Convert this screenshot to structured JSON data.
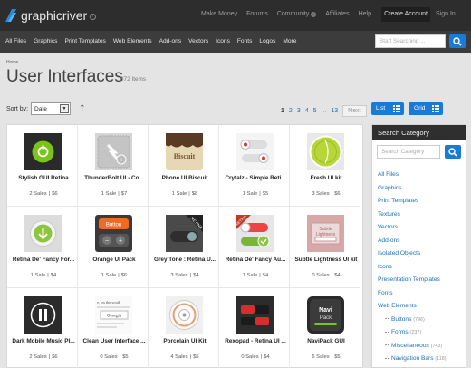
{
  "brand": {
    "name": "graphicriver"
  },
  "top_links": [
    "Make Money",
    "Forums",
    "Community",
    "Affiliates",
    "Help"
  ],
  "account": {
    "create": "Create Account",
    "signin": "Sign In"
  },
  "category_nav": [
    "All Files",
    "Graphics",
    "Print Templates",
    "Web Elements",
    "Add-ons",
    "Vectors",
    "Icons",
    "Fonts",
    "Logos",
    "More"
  ],
  "search": {
    "placeholder": "Start Searching ..."
  },
  "breadcrumb": "Home",
  "page": {
    "title": "User Interfaces",
    "count": "372 Items"
  },
  "sort": {
    "label": "Sort by:",
    "value": "Date"
  },
  "pagination": {
    "pages": [
      "1",
      "2",
      "3",
      "4",
      "5"
    ],
    "dots": "...",
    "last": "13",
    "next": "Next"
  },
  "view": {
    "list": "List",
    "grid": "Grid"
  },
  "items": [
    {
      "name": "Stylish GUI Retina",
      "sales": "2 Sales",
      "price": "$6"
    },
    {
      "name": "ThunderBolt UI - Co...",
      "sales": "1 Sale",
      "price": "$7"
    },
    {
      "name": "Phone UI Biscuit",
      "sales": "1 Sale",
      "price": "$8"
    },
    {
      "name": "Crytalz - Simple Reti...",
      "sales": "1 Sale",
      "price": "$5"
    },
    {
      "name": "Fresh UI kit",
      "sales": "3 Sales",
      "price": "$6"
    },
    {
      "name": "Retina De' Fancy For...",
      "sales": "1 Sale",
      "price": "$4"
    },
    {
      "name": "Orange UI Pack",
      "sales": "1 Sale",
      "price": "$6"
    },
    {
      "name": "Grey Tone : Retina U...",
      "sales": "3 Sales",
      "price": "$4"
    },
    {
      "name": "Retina De' Fancy Au...",
      "sales": "1 Sale",
      "price": "$4"
    },
    {
      "name": "Subtle Lightness UI kit",
      "sales": "0 Sales",
      "price": "$4"
    },
    {
      "name": "Dark Mobile Music Pl...",
      "sales": "2 Sales",
      "price": "$6"
    },
    {
      "name": "Clean User Interface ...",
      "sales": "0 Sales",
      "price": "$5"
    },
    {
      "name": "Porcelain UI Kit",
      "sales": "4 Sales",
      "price": "$5"
    },
    {
      "name": "Rexopad - Retina UI ...",
      "sales": "0 Sales",
      "price": "$4"
    },
    {
      "name": "NaviPack GUI",
      "sales": "6 Sales",
      "price": "$5"
    }
  ],
  "thumb_text": {
    "orange_button": "Button",
    "biscuit": "Biscuit",
    "retina_badge": "RETINA",
    "retina_ribbon": "RETINA",
    "subtle_line1": "Subtle",
    "subtle_line2": "Lightness",
    "clean_line1": "e, on the south",
    "clean_line2": "Georgia",
    "navi_line1": "Navi",
    "navi_line2": "Pack"
  },
  "sidebar": {
    "title": "Search Category",
    "search_placeholder": "Search Category",
    "categories": [
      "All Files",
      "Graphics",
      "Print Templates",
      "Textures",
      "Vectors",
      "Add-ons",
      "Isolated Objects",
      "Icons",
      "Presentation Templates",
      "Fonts",
      "Web Elements"
    ],
    "subcategories": [
      {
        "label": "Buttons",
        "count": "(796)"
      },
      {
        "label": "Forms",
        "count": "(237)"
      },
      {
        "label": "Miscellaneous",
        "count": "(743)"
      },
      {
        "label": "Navigation Bars",
        "count": "(118)"
      }
    ]
  },
  "colors": {
    "accent": "#1b7ad3",
    "topbar": "#2d2d2d",
    "catnav": "#3c3c3c"
  }
}
